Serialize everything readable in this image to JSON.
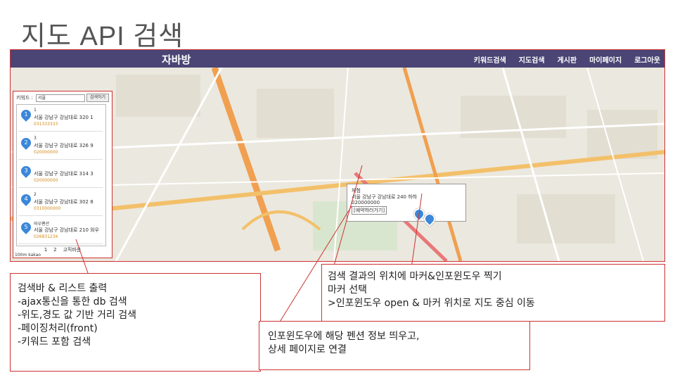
{
  "slide": {
    "title": "지도 API 검색"
  },
  "app": {
    "brand": "자바방",
    "menu": [
      "키워드검색",
      "지도검색",
      "게시판",
      "마이페이지",
      "로그아웃"
    ]
  },
  "search": {
    "label": "키워드 :",
    "value": "서울",
    "button": "검색하기"
  },
  "results": [
    {
      "name": "1",
      "address": "서울 강남구 강남대로 320 1",
      "phone": "031333333"
    },
    {
      "name": "3",
      "address": "서울 강남구 강남대로 326 9",
      "phone": "020000000"
    },
    {
      "name": "",
      "address": "서울 강남구 강남대로 314 3",
      "phone": "020000000"
    },
    {
      "name": "2",
      "address": "서울 강남구 강남대로 302 8",
      "phone": "0310000000"
    },
    {
      "name": "와우펜션",
      "address": "서울 강남구 강남대로 210 와우",
      "phone": "026831234"
    }
  ],
  "pager": {
    "pages": [
      "1",
      "2"
    ],
    "extra": "고직바운"
  },
  "map": {
    "scale": "100m",
    "provider": "kakao",
    "infowindow": {
      "name": "체험",
      "address": "서울 강남구 강남대로 240 하하",
      "phone": "020000000",
      "link": "[예약하러가기]"
    }
  },
  "captions": {
    "left": [
      "검색바 & 리스트 출력",
      "-ajax통신을 통한 db 검색",
      "-위도,경도 값 기반 거리 검색",
      "-페이징처리(front)",
      "-키워드 포함 검색"
    ],
    "right": [
      "검색 결과의 위치에 마커&인포윈도우 찍기",
      "마커 선택",
      ">인포윈도우 open & 마커 위치로 지도 중심 이동"
    ],
    "bottom": [
      "인포윈도우에 해당 펜션 정보 띄우고,",
      "상세 페이지로 연결"
    ]
  },
  "colors": {
    "nav": "#4a4575",
    "callout": "#cc3333",
    "marker": "#3b87d9"
  }
}
